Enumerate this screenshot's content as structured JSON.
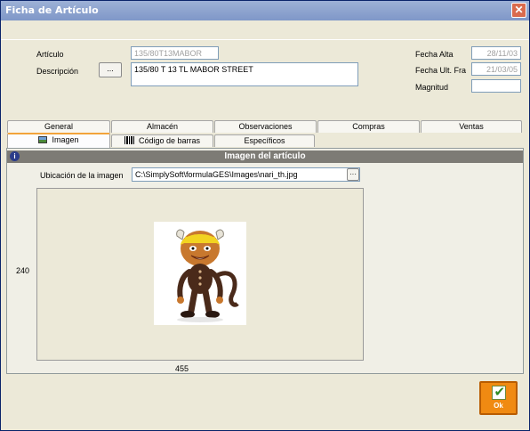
{
  "window": {
    "title": "Ficha de Artículo",
    "close_symbol": "✕"
  },
  "header": {
    "articulo_label": "Artículo",
    "articulo_value": "135/80T13MABOR",
    "descripcion_label": "Descripción",
    "descripcion_button": "...",
    "descripcion_value": "135/80 T 13 TL MABOR STREET",
    "fecha_alta_label": "Fecha Alta",
    "fecha_alta_value": "28/11/03",
    "fecha_ult_label": "Fecha Ult. Fra",
    "fecha_ult_value": "21/03/05",
    "magnitud_label": "Magnitud",
    "magnitud_value": ""
  },
  "tabs_row1": [
    "General",
    "Almacén",
    "Observaciones",
    "Compras",
    "Ventas"
  ],
  "tabs_row2": [
    "Imagen",
    "Código de barras",
    "Específicos"
  ],
  "section": {
    "title": "Imagen del artículo",
    "ubicacion_label": "Ubicación de la imagen",
    "ubicacion_value": "C:\\SimplySoft\\formulaGES\\Images\\nari_th.jpg",
    "browse_label": "···",
    "height_value": "240",
    "width_value": "455"
  },
  "ok_label": "Ok",
  "colors": {
    "ok_button": "#f08a12",
    "active_tab_accent": "#f2a33b",
    "section_bar": "#7d7b75"
  }
}
